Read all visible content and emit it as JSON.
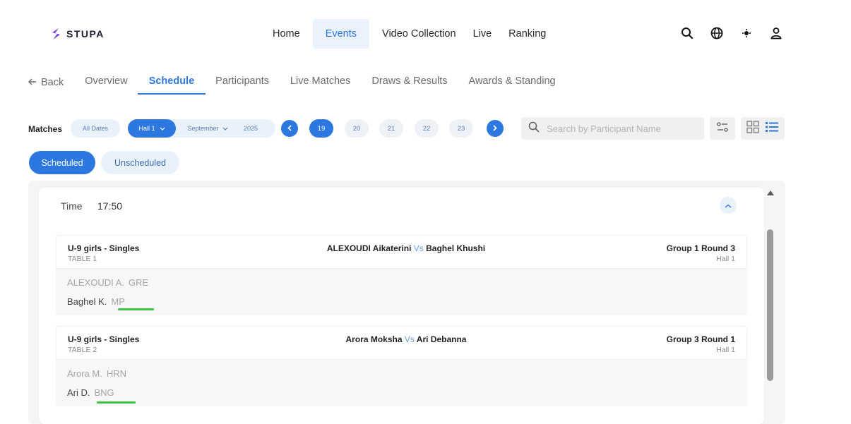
{
  "app": {
    "brand": "STUPA"
  },
  "topnav": {
    "items": [
      {
        "label": "Home"
      },
      {
        "label": "Events"
      },
      {
        "label": "Video Collection"
      },
      {
        "label": "Live"
      },
      {
        "label": "Ranking"
      }
    ]
  },
  "subnav": {
    "back": "Back",
    "items": [
      {
        "label": "Overview"
      },
      {
        "label": "Schedule"
      },
      {
        "label": "Participants"
      },
      {
        "label": "Live Matches"
      },
      {
        "label": "Draws & Results"
      },
      {
        "label": "Awards & Standing"
      }
    ]
  },
  "filters": {
    "matches_label": "Matches",
    "all_dates": "All Dates",
    "hall": "Hall 1",
    "month": "September",
    "year": "2025",
    "days": [
      "19",
      "20",
      "21",
      "22",
      "23"
    ],
    "active_day": "19"
  },
  "search": {
    "placeholder": "Search by Participant Name"
  },
  "tabs": {
    "scheduled": "Scheduled",
    "unscheduled": "Unscheduled"
  },
  "schedule": {
    "time_label": "Time",
    "time_value": "17:50",
    "matches": [
      {
        "event": "U-9 girls - Singles",
        "table": "TABLE 1",
        "player_a": "ALEXOUDI Aikaterini",
        "vs": "Vs",
        "player_b": "Baghel Khushi",
        "round": "Group 1 Round 3",
        "hall": "Hall 1",
        "line1_name": "ALEXOUDI A.",
        "line1_country": "GRE",
        "line2_name": "Baghel K.",
        "line2_country": "MP"
      },
      {
        "event": "U-9 girls - Singles",
        "table": "TABLE 2",
        "player_a": "Arora Moksha",
        "vs": "Vs",
        "player_b": "Ari Debanna",
        "round": "Group 3 Round 1",
        "hall": "Hall 1",
        "line1_name": "Arora M.",
        "line1_country": "HRN",
        "line2_name": "Ari D.",
        "line2_country": "BNG"
      }
    ]
  },
  "colors": {
    "accent": "#2d78e0",
    "accent_light": "#e9f1fb",
    "highlight": "#3fc43f"
  }
}
